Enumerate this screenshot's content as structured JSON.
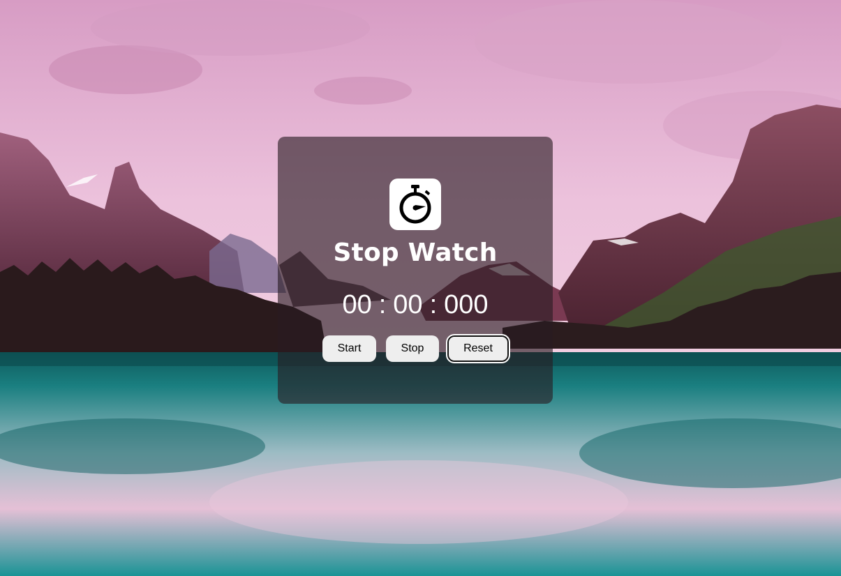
{
  "background": {
    "description_colors": {
      "sky": "#e8b8d4",
      "mountain": "#8a4a68",
      "forest": "#2a1a1c",
      "lake": "#1e8f90"
    }
  },
  "stopwatch": {
    "icon": "stopwatch-icon",
    "title": "Stop Watch",
    "minutes": "00",
    "seconds": "00",
    "milliseconds": "000",
    "separator": ":",
    "buttons": {
      "start": "Start",
      "stop": "Stop",
      "reset": "Reset"
    }
  }
}
